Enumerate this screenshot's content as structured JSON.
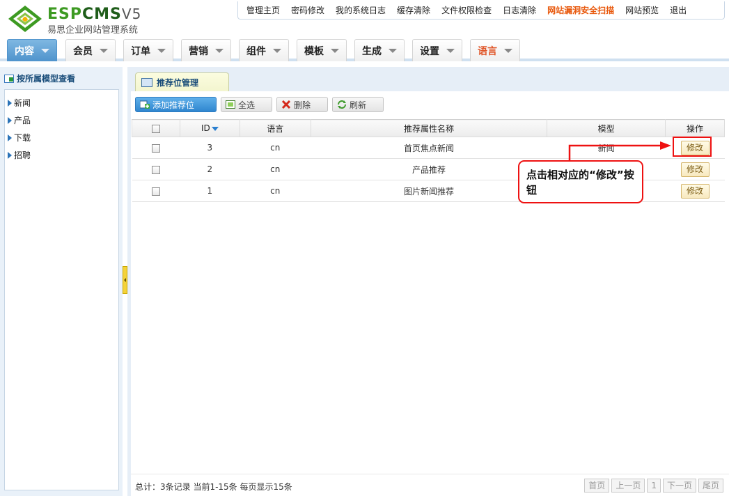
{
  "header": {
    "logo_brand_a": "ESP",
    "logo_brand_b": "CMS",
    "logo_version": "V5",
    "logo_subtitle": "易思企业网站管理系统"
  },
  "top_links": [
    "管理主页",
    "密码修改",
    "我的系统日志",
    "缓存清除",
    "文件权限检查",
    "日志清除",
    "网站漏洞安全扫描",
    "网站预览",
    "退出"
  ],
  "main_tabs": [
    "内容",
    "会员",
    "订单",
    "营销",
    "组件",
    "模板",
    "生成",
    "设置",
    "语言"
  ],
  "sidebar": {
    "title": "按所属模型查看",
    "items": [
      "新闻",
      "产品",
      "下载",
      "招聘"
    ]
  },
  "panel": {
    "tab_title": "推荐位管理",
    "toolbar": {
      "add": "添加推荐位",
      "select_all": "全选",
      "delete": "删除",
      "refresh": "刷新"
    }
  },
  "table": {
    "headers": [
      "",
      "ID",
      "语言",
      "推荐属性名称",
      "模型",
      "操作"
    ],
    "rows": [
      {
        "id": "3",
        "lang": "cn",
        "name": "首页焦点新闻",
        "model": "新闻",
        "action": "修改"
      },
      {
        "id": "2",
        "lang": "cn",
        "name": "产品推荐",
        "model": "",
        "action": "修改"
      },
      {
        "id": "1",
        "lang": "cn",
        "name": "图片新闻推荐",
        "model": "",
        "action": "修改"
      }
    ]
  },
  "annotation": {
    "text": "点击相对应的“修改”按钮"
  },
  "footer": {
    "summary": "总计：3条记录 当前1-15条 每页显示15条",
    "pager": [
      "首页",
      "上一页",
      "1",
      "下一页",
      "尾页"
    ]
  },
  "colors": {
    "accent_blue": "#4f93cc",
    "annotation_red": "#e11111",
    "brand_green": "#3d9a22",
    "hot_link": "#e8580c"
  }
}
